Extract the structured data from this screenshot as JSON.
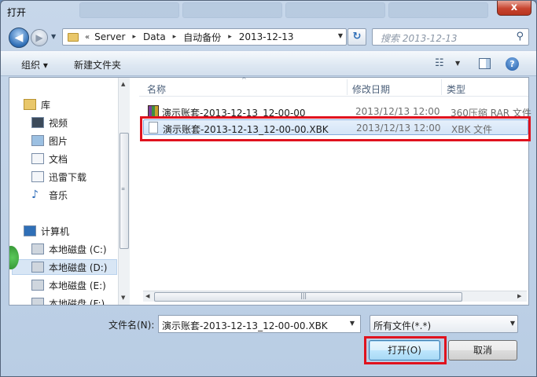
{
  "window": {
    "title": "打开",
    "close_label": "x"
  },
  "nav": {
    "back_glyph": "◀",
    "forward_glyph": "▶",
    "recent_glyph": "▼",
    "address": {
      "chevron": "«",
      "segments": [
        "Server",
        "Data",
        "自动备份",
        "2013-12-13"
      ],
      "separator": "▸",
      "dropdown": "▼"
    },
    "refresh_glyph": "↻",
    "search_placeholder": "搜索 2013-12-13",
    "search_glyph": "⚲"
  },
  "toolbar": {
    "organize_label": "组织 ▾",
    "new_folder_label": "新建文件夹",
    "view_glyph": "☷",
    "view_drop": "▼",
    "help_glyph": "?"
  },
  "navpane": {
    "items": [
      {
        "label": "库",
        "icon": "library-icon"
      },
      {
        "label": "视频",
        "icon": "video-icon"
      },
      {
        "label": "图片",
        "icon": "picture-icon"
      },
      {
        "label": "文档",
        "icon": "document-icon"
      },
      {
        "label": "迅雷下载",
        "icon": "download-icon"
      },
      {
        "label": "音乐",
        "icon": "music-icon"
      },
      {
        "label": "计算机",
        "icon": "computer-icon"
      },
      {
        "label": "本地磁盘 (C:)",
        "icon": "drive-icon"
      },
      {
        "label": "本地磁盘 (D:)",
        "icon": "drive-icon"
      },
      {
        "label": "本地磁盘 (E:)",
        "icon": "drive-icon"
      },
      {
        "label": "本地磁盘 (F:)",
        "icon": "drive-icon"
      }
    ],
    "selected_index": 8
  },
  "files": {
    "columns": [
      "名称",
      "修改日期",
      "类型"
    ],
    "rows": [
      {
        "name": "演示账套-2013-12-13_12-00-00",
        "modified": "2013/12/13 12:00",
        "type": "360压缩 RAR 文件",
        "icon": "rar-icon"
      },
      {
        "name": "演示账套-2013-12-13_12-00-00.XBK",
        "modified": "2013/12/13 12:00",
        "type": "XBK 文件",
        "icon": "document-icon"
      }
    ],
    "selected_index": 1
  },
  "footer": {
    "filename_label": "文件名(N):",
    "filename_value": "演示账套-2013-12-13_12-00-00.XBK",
    "filetype_value": "所有文件(*.*)",
    "open_label": "打开(O)",
    "cancel_label": "取消"
  },
  "colors": {
    "highlight_box": "#e0121e",
    "selection_bg": "#d3e4f7"
  }
}
